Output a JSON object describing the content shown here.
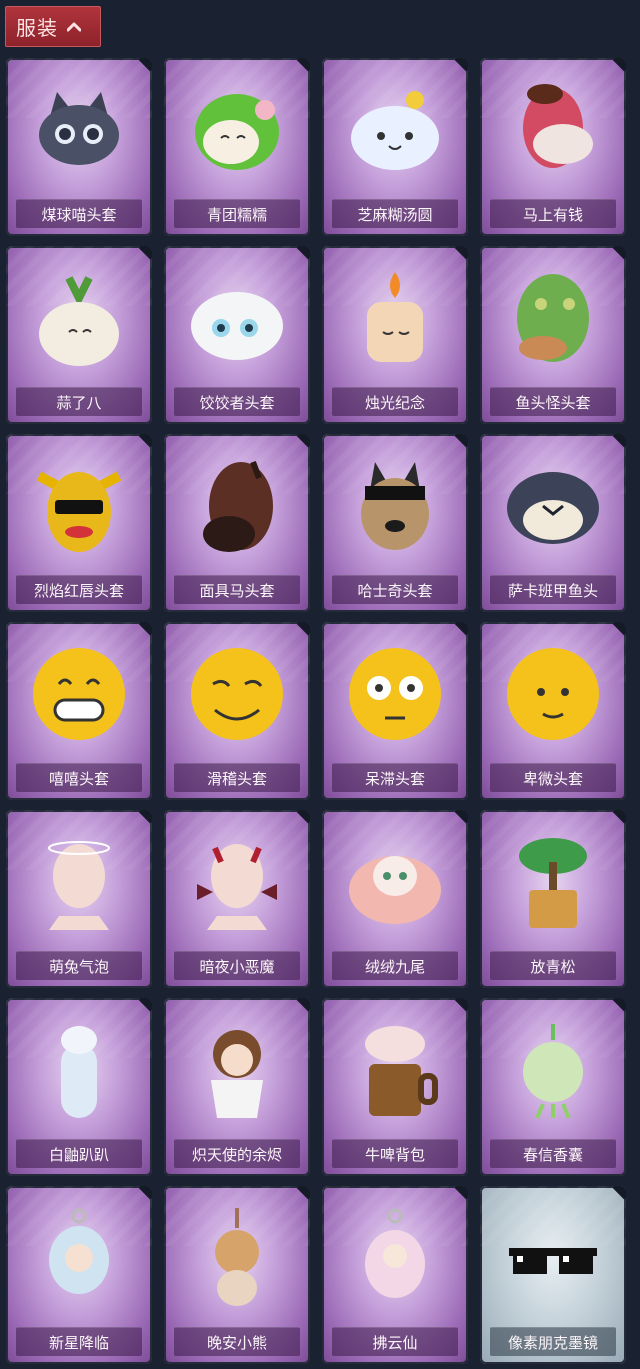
{
  "header": {
    "title": "服装",
    "toggle_icon": "chevron-up-icon"
  },
  "items": [
    {
      "label": "煤球喵头套",
      "icon": "black-cat-head-icon"
    },
    {
      "label": "青团糯糯",
      "icon": "green-dumpling-head-icon"
    },
    {
      "label": "芝麻糊汤圆",
      "icon": "white-rice-ball-head-icon"
    },
    {
      "label": "马上有钱",
      "icon": "red-horse-head-icon"
    },
    {
      "label": "蒜了八",
      "icon": "garlic-head-icon"
    },
    {
      "label": "饺饺者头套",
      "icon": "dumpling-head-icon"
    },
    {
      "label": "烛光纪念",
      "icon": "candle-head-icon"
    },
    {
      "label": "鱼头怪头套",
      "icon": "fish-head-mask-icon"
    },
    {
      "label": "烈焰红唇头套",
      "icon": "yellow-mascot-head-icon"
    },
    {
      "label": "面具马头套",
      "icon": "horse-mask-icon"
    },
    {
      "label": "哈士奇头套",
      "icon": "dog-head-sunglasses-icon"
    },
    {
      "label": "萨卡班甲鱼头",
      "icon": "fish-head-icon"
    },
    {
      "label": "嘻嘻头套",
      "icon": "grinning-emoji-head-icon"
    },
    {
      "label": "滑稽头套",
      "icon": "smirking-emoji-head-icon"
    },
    {
      "label": "呆滞头套",
      "icon": "staring-emoji-head-icon"
    },
    {
      "label": "卑微头套",
      "icon": "shy-emoji-head-icon"
    },
    {
      "label": "萌兔气泡",
      "icon": "bunny-bubble-icon"
    },
    {
      "label": "暗夜小恶魔",
      "icon": "little-devil-icon"
    },
    {
      "label": "绒绒九尾",
      "icon": "nine-tail-fox-icon"
    },
    {
      "label": "放青松",
      "icon": "potted-pine-icon"
    },
    {
      "label": "白鼬趴趴",
      "icon": "white-weasel-icon"
    },
    {
      "label": "炽天使的余烬",
      "icon": "angel-figure-icon"
    },
    {
      "label": "牛啤背包",
      "icon": "cow-beer-mug-icon"
    },
    {
      "label": "春信香囊",
      "icon": "sachet-icon"
    },
    {
      "label": "新星降临",
      "icon": "star-keychain-icon"
    },
    {
      "label": "晚安小熊",
      "icon": "bear-keychain-icon"
    },
    {
      "label": "拂云仙",
      "icon": "fairy-keychain-icon"
    },
    {
      "label": "像素朋克墨镜",
      "icon": "pixel-sunglasses-icon"
    }
  ]
}
